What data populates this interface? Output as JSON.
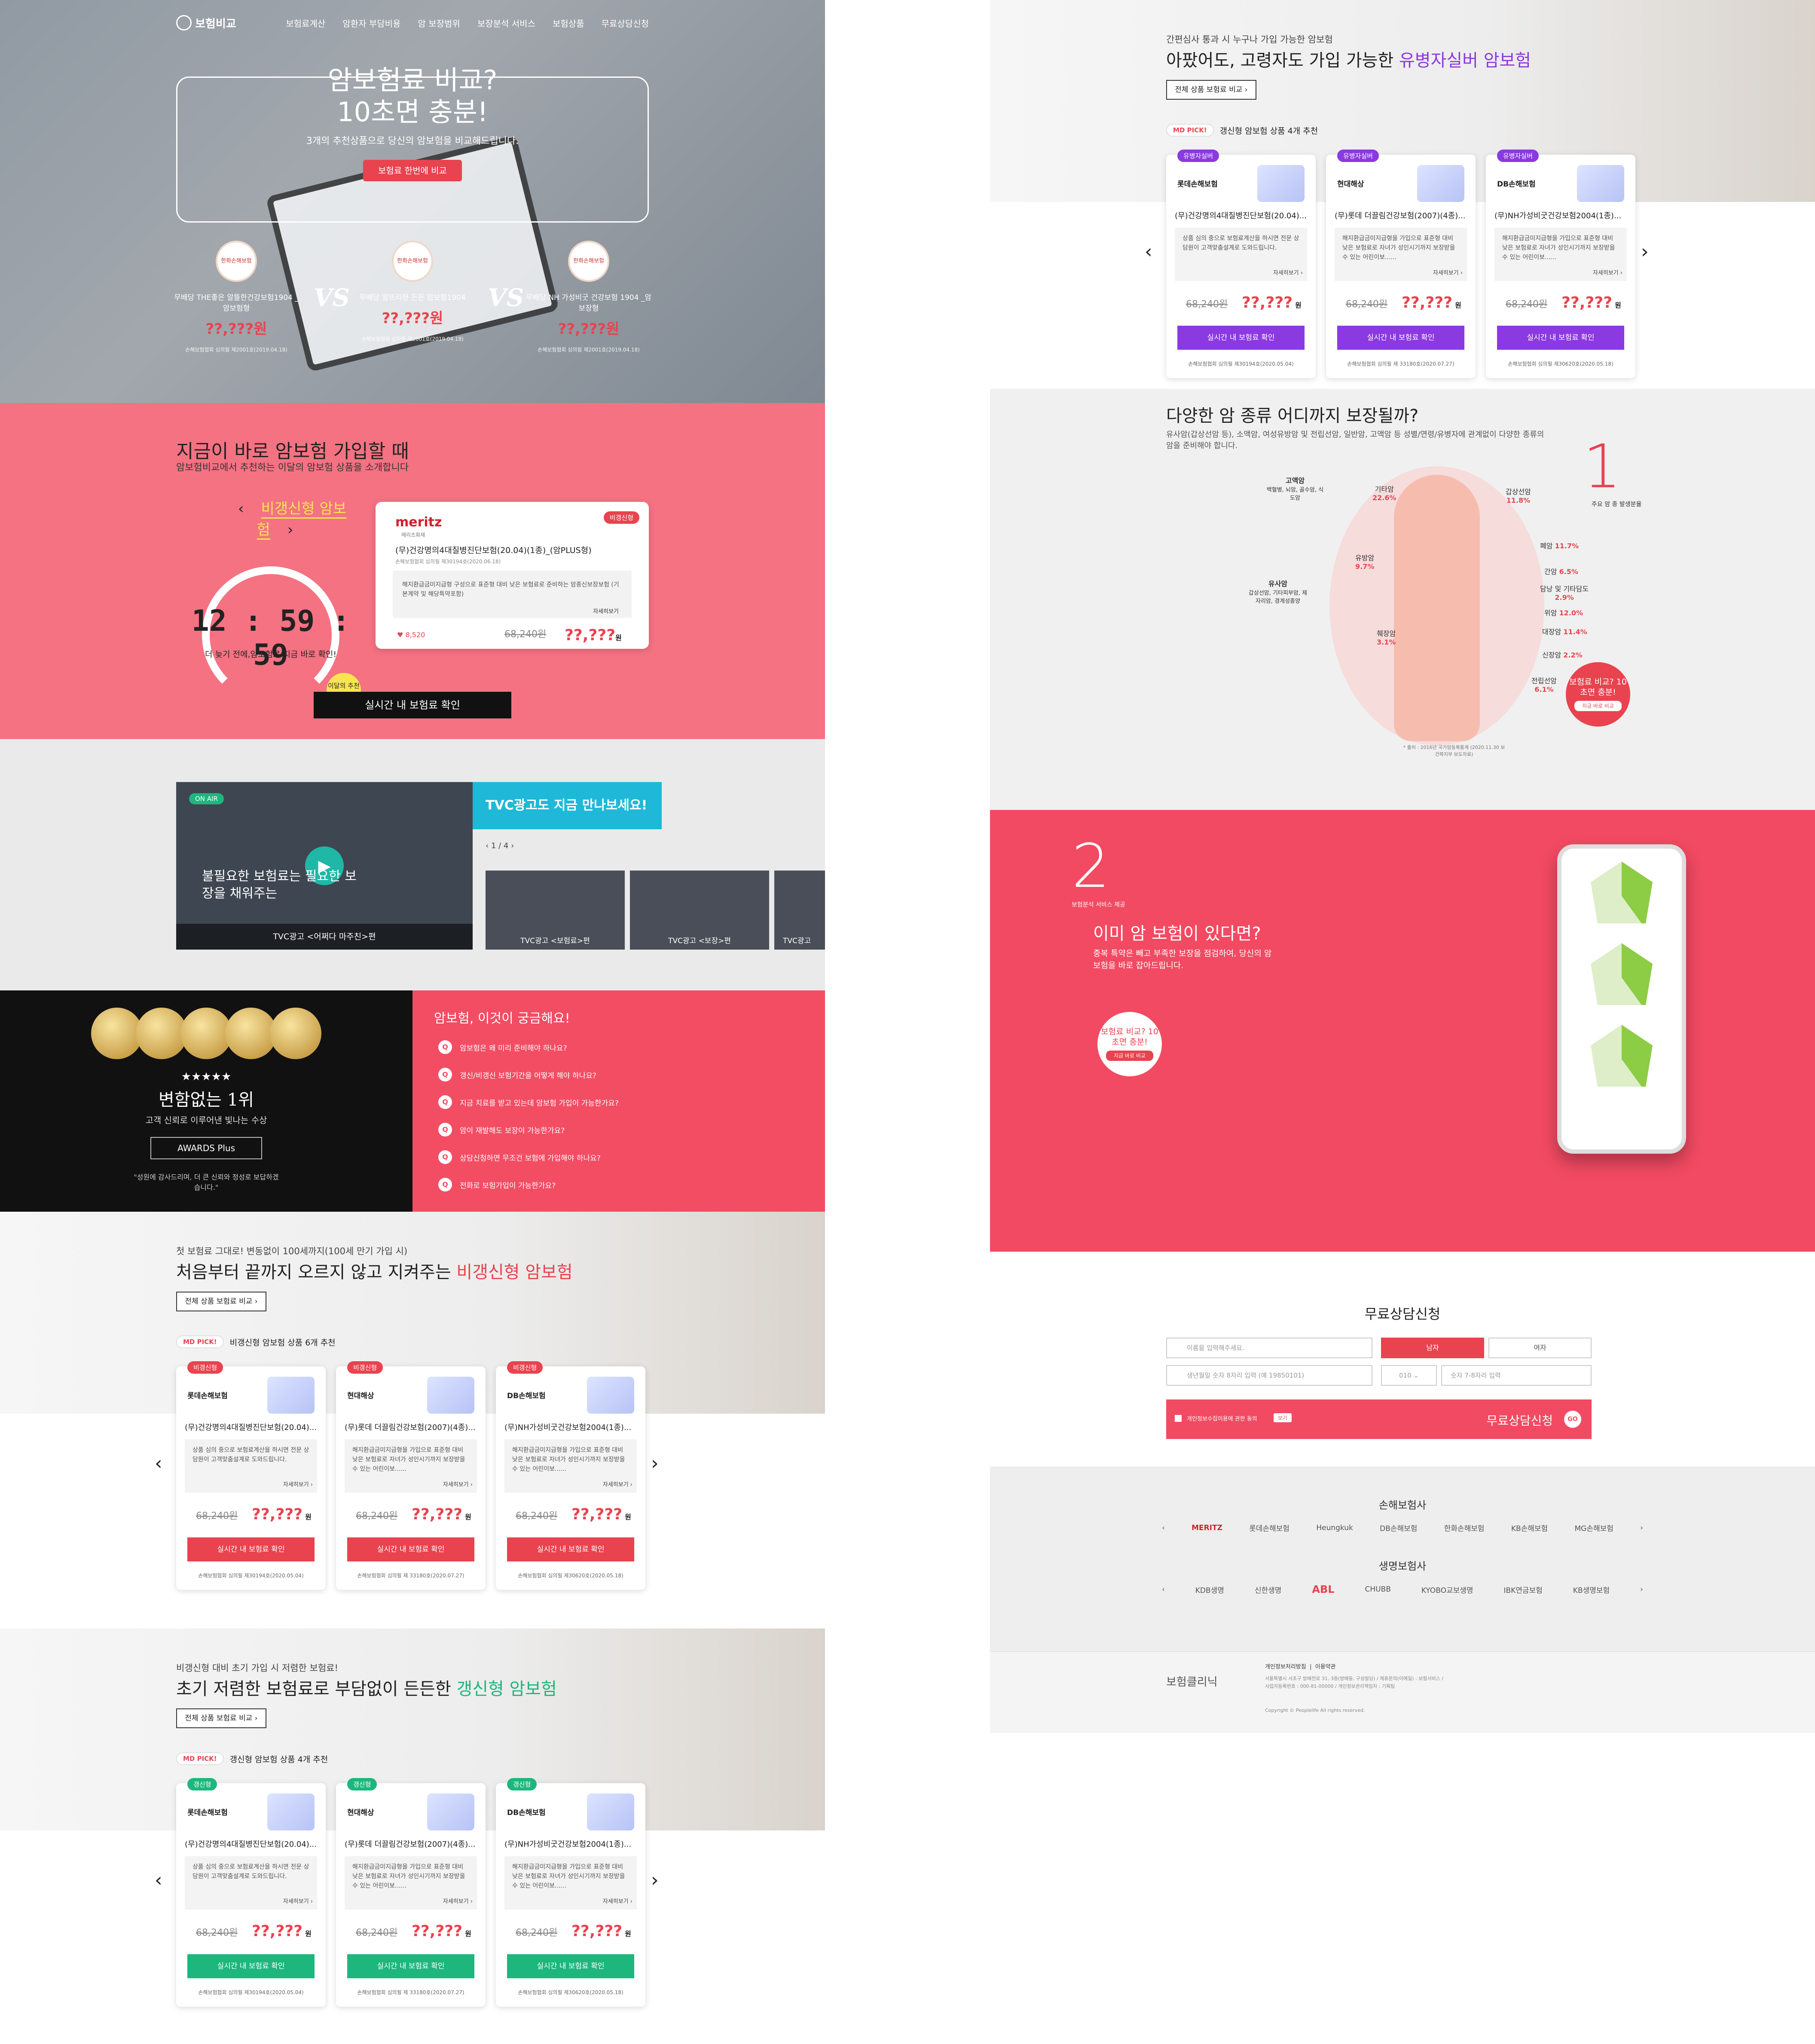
{
  "hero": {
    "logo": "보험비교",
    "nav": [
      "보험료계산",
      "암환자 부담비용",
      "암 보장범위",
      "보장분석 서비스",
      "보험상품",
      "무료상담신청"
    ],
    "title_line1": "암보험료 비교?",
    "title_line2": "10초면 충분!",
    "subtitle": "3개의 추천상품으로 당신의 암보험을 비교해드립니다.",
    "button": "보험료 한번에 비교",
    "compare": [
      {
        "logo": "한화손해보험",
        "name": "무배당 THE좋은 알뜰한건강보험1904 _암보험형",
        "price": "??,???원",
        "foot": "손해보험협회 심의필 제2001호(2019.04.18)"
      },
      {
        "logo": "한화손해보험",
        "name": "무배당 알뜨리헌 든든 암보험1904",
        "price": "??,???원",
        "foot": "손해보험협회 심의필 제2001호(2019.04.18)"
      },
      {
        "logo": "한화손해보험",
        "name": "무배당 NH 가성비굿 건강보험 1904 _암보장형",
        "price": "??,???원",
        "foot": "손해보험협회 심의필 제2001호(2019.04.18)"
      }
    ],
    "vs": "VS"
  },
  "promo": {
    "title": "지금이 바로 암보험 가입할 때",
    "subtitle": "암보험비교에서 추천하는 이달의 암보험 상품을 소개합니다",
    "carousel_label": "비갱신형 암보험",
    "prev": "‹",
    "next": "›",
    "timer": "12 : 59 : 59",
    "timer_caption": "더 늦기 전에,암보험료 지금 바로 확인!",
    "card": {
      "brand": "meritz",
      "brand_sub": "메리츠화재",
      "tag": "비갱신형",
      "name": "(무)건강명의4대질병진단보험(20.04)(1종)_(암PLUS형)",
      "review": "손해보험협회 심의필 제30194호(2020.06.18)",
      "desc": "해지환급금미지급형 구성으로 표준형 대비 낮은 보험료로 준비하는 암종신보장보험 (기본계약 및 해당특약포함)",
      "more": "자세히보기",
      "likes": "8,520",
      "old_price": "68,240원",
      "new_price": "??,???",
      "won": "원"
    },
    "badge": "이달의 추천",
    "cta": "실시간 내 보험료 확인"
  },
  "tvc": {
    "onair": "ON AIR",
    "caption": "불필요한 보험료는 필요한 보장을 채워주는",
    "main_label": "TVC광고 <어쩌다 마주친>편",
    "header": "TVC광고도 지금 만나보세요!",
    "pager": "1 / 4",
    "thumbs": [
      "TVC광고 <보험료>편",
      "TVC광고 <보장>편",
      "TVC광고"
    ]
  },
  "awards": {
    "stars": "★★★★★",
    "title": "변함없는 1위",
    "subtitle": "고객 신뢰로 이루어낸 빛나는 수상",
    "button": "AWARDS Plus",
    "quote": "\"성원에 감사드리며, 더 큰 신뢰와 정성로 보답하겠습니다.\""
  },
  "faq": {
    "title": "암보험, 이것이 궁금해요!",
    "items": [
      "암보험은 왜 미리 준비해야 하나요?",
      "갱신/비갱신 보험기간을 어떻게 해야 하나요?",
      "지금 치료를 받고 있는데 암보험 가입이 가능한가요?",
      "암이 재발해도 보장이 가능한가요?",
      "상담신청하면 무조건 보험에 가입해야 하나요?",
      "전화로 보험가입이 가능한가요?"
    ]
  },
  "sections": [
    {
      "lead": "첫 보험료 그대로! 변동없이 100세까지(100세 만기 가입 시)",
      "title": "처음부터 끝까지 오르지 않고 지켜주는",
      "title_hl": "비갱신형 암보험",
      "all": "전체 상품 보험료 비교 ›",
      "md": "MD PICK!",
      "md_label": "비갱신형 암보험 상품 6개 추천",
      "tag": "비갱신형",
      "color": "#e8434f"
    },
    {
      "lead": "비갱신형 대비 초기 가입 시 저렴한 보험료!",
      "title": "초기 저렴한 보험료로 부담없이 든든한",
      "title_hl": "갱신형 암보험",
      "all": "전체 상품 보험료 비교 ›",
      "md": "MD PICK!",
      "md_label": "갱신형 암보험 상품 4개 추천",
      "tag": "갱신형",
      "color": "#1db77d"
    },
    {
      "lead": "간편심사 통과 시 누구나 가입 가능한 암보험",
      "title": "아팠어도, 고령자도 가입 가능한",
      "title_hl": "유병자실버 암보험",
      "all": "전체 상품 보험료 비교 ›",
      "md": "MD PICK!",
      "md_label": "갱신형 암보험 상품 4개 추천",
      "tag": "유병자실버",
      "color": "#8b39e0"
    }
  ],
  "products": [
    {
      "logo": "롯데손해보험",
      "name": "(무)건강명의4대질병진단보험(20.04)...",
      "desc": "상품 심의 중으로 보험료계산을 하시면 전문 상담원이 고객맞춤설계로 도와드립니다.",
      "more": "자세히보기 ›",
      "old": "68,240원",
      "new": "??,???",
      "won": "원",
      "btn": "실시간 내 보험료 확인",
      "foot": "손해보험협회 심의필 제30194호(2020.05.04)"
    },
    {
      "logo": "현대해상",
      "name": "(무)롯데 더끌림건강보험(2007)(4종)...",
      "desc": "해지환급금미지급형을 가입으로 표준형 대비 낮은 보험료로 자녀가 성인시기까지 보장받을수 있는 어린이보......",
      "more": "자세히보기 ›",
      "old": "68,240원",
      "new": "??,???",
      "won": "원",
      "btn": "실시간 내 보험료 확인",
      "foot": "손해보험협회 심의필 제 33180호(2020.07.27)"
    },
    {
      "logo": "DB손해보험",
      "name": "(무)NH가성비굿건강보험2004(1종)...",
      "desc": "해지환급금미지급형을 가입으로 표준형 대비 낮은 보험료로 자녀가 성인시기까지 보장받을수 있는 어린이보......",
      "more": "자세히보기 ›",
      "old": "68,240원",
      "new": "??,???",
      "won": "원",
      "btn": "실시간 내 보험료 확인",
      "foot": "손해보험협회 심의필 제30620호(2020.05.18)"
    }
  ],
  "cancer": {
    "title": "다양한 암 종류 어디까지 보장될까?",
    "intro": "유사암(갑상선암 등), 소액암, 여성유방암 및 전립선암, 일반암, 고액암 등 성별/연령/유병자에 관계없이 다양한 종류의 암을 준비해야 합니다.",
    "num": "1",
    "num_caption": "주요 암 종 발생분율",
    "groups": [
      {
        "name": "고액암",
        "items": "백혈병, 뇌암, 골수암, 식도암"
      },
      {
        "name": "유사암",
        "items": "갑상선암, 기타피부암, 제자리암, 경계성종양"
      }
    ],
    "stats": [
      {
        "name": "기타암",
        "value": "22.6%"
      },
      {
        "name": "갑상선암",
        "value": "11.8%"
      },
      {
        "name": "유방암",
        "value": "9.7%"
      },
      {
        "name": "폐암",
        "value": "11.7%"
      },
      {
        "name": "간암",
        "value": "6.5%"
      },
      {
        "name": "담낭 및 기타담도",
        "value": "2.9%"
      },
      {
        "name": "위암",
        "value": "12.0%"
      },
      {
        "name": "대장암",
        "value": "11.4%"
      },
      {
        "name": "췌장암",
        "value": "3.1%"
      },
      {
        "name": "신장암",
        "value": "2.2%"
      },
      {
        "name": "전립선암",
        "value": "6.1%"
      }
    ],
    "source": "* 출처 : 2016년 국가암등록통계 (2020.11.30 보건복지부 보도자료)",
    "badge": "보험료 비교? 10초면 충분!",
    "badge_btn": "지금 바로 비교"
  },
  "service": {
    "num": "2",
    "num_caption": "보험분석 서비스 제공",
    "title": "이미 암 보험이 있다면?",
    "desc": "중복 특약은 빼고 부족한 보장을 점검하여, 당신의 암보험을 바로 잡아드립니다.",
    "badge": "보험료 비교? 10초면 충분!",
    "badge_btn": "지금 바로 비교"
  },
  "form": {
    "title": "무료상담신청",
    "name_ph": "이름을 입력해주세요.",
    "male": "남자",
    "female": "여자",
    "birth_ph": "생년월일 숫자 8자리 입력 (예 19850101)",
    "phone_prefix": "010",
    "phone_ph": "숫자 7-8자리 입력",
    "agree": "개인정보수집이용에 관한 동의",
    "view": "보기",
    "submit": "무료상담신청",
    "go": "GO"
  },
  "partners": {
    "nonlife_title": "손해보험사",
    "nonlife": [
      "MERITZ",
      "롯데손해보험",
      "Heungkuk",
      "DB손해보험",
      "한화손해보험",
      "KB손해보험",
      "MG손해보험"
    ],
    "life_title": "생명보험사",
    "life": [
      "KDB생명",
      "신한생명",
      "ABL",
      "CHUBB",
      "KYOBO교보생명",
      "IBK연금보험",
      "KB생명보험"
    ]
  },
  "footer": {
    "logo": "보험클리닉",
    "links": [
      "개인정보처리방침",
      "이용약관"
    ],
    "info": "서울특별시 서초구 방배천로 31, 3층(방배동, 구성빌딩) / 제휴문의(이메일) : 보험서비스 / 사업자등록번호 : 000-81-00000 / 개인정보관리책임자 : 기획팀",
    "copyright": "Copyright © Peoplelife All rights reserved."
  }
}
